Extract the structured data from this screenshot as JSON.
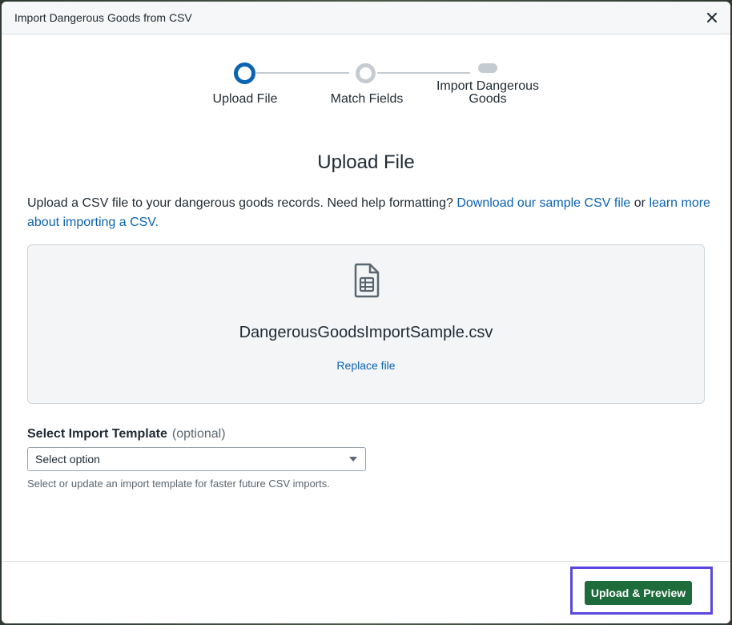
{
  "modal": {
    "title": "Import Dangerous Goods from CSV",
    "close_icon": "close-icon"
  },
  "stepper": {
    "steps": [
      {
        "label": "Upload File",
        "state": "current"
      },
      {
        "label": "Match Fields",
        "state": "upcoming"
      },
      {
        "label_line1": "Import Dangerous",
        "label_line2": "Goods",
        "state": "upcoming"
      }
    ]
  },
  "upload": {
    "title": "Upload File",
    "intro_text": "Upload a CSV file to your dangerous goods records. Need help formatting?",
    "download_link": "Download our sample CSV file",
    "or_text": "or",
    "learn_link": "learn more about importing a CSV.",
    "file_icon": "spreadsheet-file-icon",
    "file_name": "DangerousGoodsImportSample.csv",
    "replace_link": "Replace file"
  },
  "template": {
    "label": "Select Import Template",
    "optional": "(optional)",
    "placeholder": "Select option",
    "helper": "Select or update an import template for faster future CSV imports."
  },
  "footer": {
    "primary_label": "Upload & Preview"
  },
  "colors": {
    "accent": "#0b63b2",
    "primary_button": "#1e6b3c",
    "highlight": "#5a47e0"
  }
}
